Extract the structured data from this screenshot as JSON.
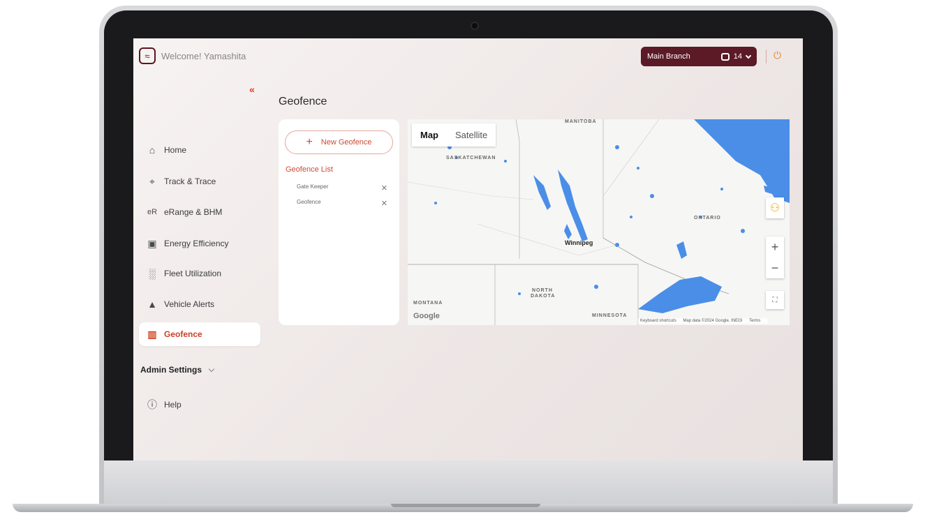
{
  "header": {
    "welcome": "Welcome! Yamashita",
    "branch_name": "Main Branch",
    "vehicle_count": "14"
  },
  "sidebar": {
    "items": [
      {
        "label": "Home",
        "icon": "home-icon"
      },
      {
        "label": "Track & Trace",
        "icon": "crosshair-icon"
      },
      {
        "label": "eRange & BHM",
        "icon": "erange-icon"
      },
      {
        "label": "Energy Efficiency",
        "icon": "fuel-pump-icon"
      },
      {
        "label": "Fleet Utilization",
        "icon": "bar-chart-icon"
      },
      {
        "label": "Vehicle Alerts",
        "icon": "bell-icon"
      },
      {
        "label": "Geofence",
        "icon": "map-icon"
      }
    ],
    "admin_settings": "Admin Settings",
    "help": "Help"
  },
  "page": {
    "title": "Geofence",
    "new_button": "New Geofence",
    "list_title": "Geofence List",
    "geofences": [
      "Gate Keeper",
      "Geofence"
    ]
  },
  "map": {
    "tabs": [
      "Map",
      "Satellite"
    ],
    "labels": {
      "manitoba": "MANITOBA",
      "saskatchewan": "SASKATCHEWAN",
      "ontario": "ONTARIO",
      "north_dakota_1": "NORTH",
      "north_dakota_2": "DAKOTA",
      "montana": "MONTANA",
      "minnesota": "MINNESOTA",
      "winnipeg": "Winnipeg"
    },
    "google": "Google",
    "attribution": {
      "shortcuts": "Keyboard shortcuts",
      "data": "Map data ©2024 Google, INEGI",
      "terms": "Terms"
    }
  },
  "colors": {
    "brand": "#5b1a25",
    "accent": "#d04a35",
    "water": "#4a8ee8"
  }
}
